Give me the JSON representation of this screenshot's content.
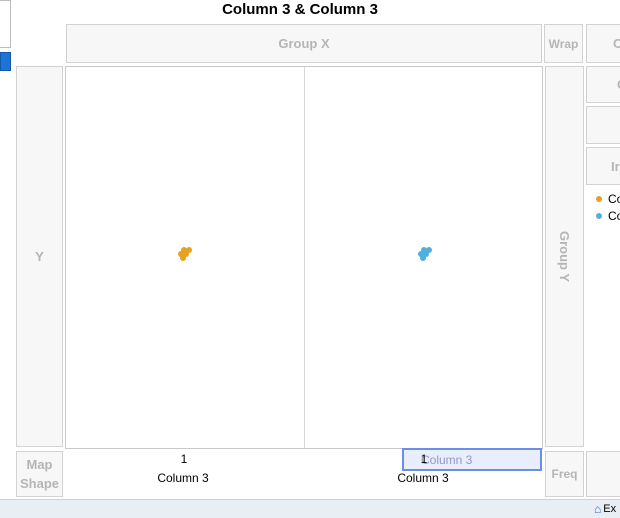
{
  "graph": {
    "title": "Column 3 & Column 3",
    "drop_zones": {
      "group_x": "Group X",
      "group_y": "Group Y",
      "wrap": "Wrap",
      "y": "Y",
      "map_shape": "Map\nShape",
      "freq": "Freq",
      "overlay_partial": "O",
      "color_partial": "C",
      "interval_partial": "Ir"
    },
    "legend": [
      {
        "label": "Co",
        "color": "#e8a020"
      },
      {
        "label": "Co",
        "color": "#4fb0e0"
      }
    ],
    "drag_ghost_label": "Column 3",
    "status_partial": "Ex"
  },
  "chart_data": {
    "type": "scatter",
    "title": "Column 3 & Column 3",
    "panels": [
      {
        "xlabel": "Column 3",
        "tick": "1",
        "series_color": "#e8a020",
        "points": 5
      },
      {
        "xlabel": "Column 3",
        "tick": "1",
        "series_color": "#4fb0e0",
        "points": 5
      }
    ],
    "ylabel": "Y",
    "grid": false
  }
}
